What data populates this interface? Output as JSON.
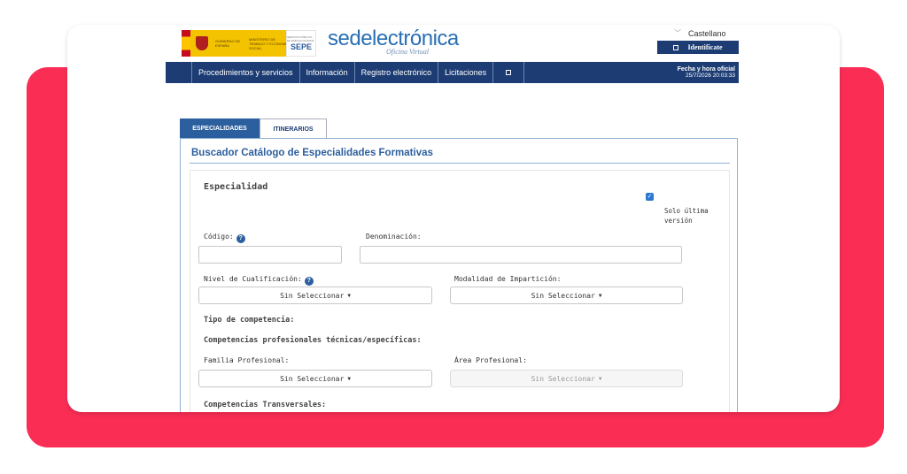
{
  "header": {
    "gov_text": "GOBIERNO DE ESPAÑA",
    "ministry_text": "MINISTERIO DE TRABAJO Y ECONOMÍA SOCIAL",
    "sepe_small": "SERVICIO PÚBLICO DE EMPLEO ESTATAL",
    "sepe_label": "SEPE",
    "site_title": "sedelectrónica",
    "site_subtitle": "Oficina Virtual",
    "language": "Castellano",
    "identify_label": "Identifícate"
  },
  "nav": {
    "items": [
      "Procedimientos y servicios",
      "Información",
      "Registro electrónico",
      "Licitaciones"
    ],
    "date_label": "Fecha y hora oficial",
    "date_value": "25/7/2026 20:03:33"
  },
  "tabs": [
    "ESPECIALIDADES",
    "ITINERARIOS"
  ],
  "form": {
    "title": "Buscador Catálogo de Especialidades Formativas",
    "section": "Especialidad",
    "checkbox_label": "Solo última versión",
    "checkbox_checked": true,
    "codigo_label": "Código:",
    "denominacion_label": "Denominación:",
    "nivel_label": "Nivel de Cualificación:",
    "modalidad_label": "Modalidad de Impartición:",
    "tipo_label": "Tipo de competencia:",
    "comp_tecnicas_label": "Competencias profesionales técnicas/específicas:",
    "familia_label": "Familia Profesional:",
    "area_label": "Área Profesional:",
    "comp_transversales_label": "Competencias Transversales:",
    "select_placeholder": "Sin Seleccionar"
  },
  "colors": {
    "accent_red": "#fa2d55",
    "navy": "#1c3c73",
    "blue": "#2c5f9e"
  }
}
